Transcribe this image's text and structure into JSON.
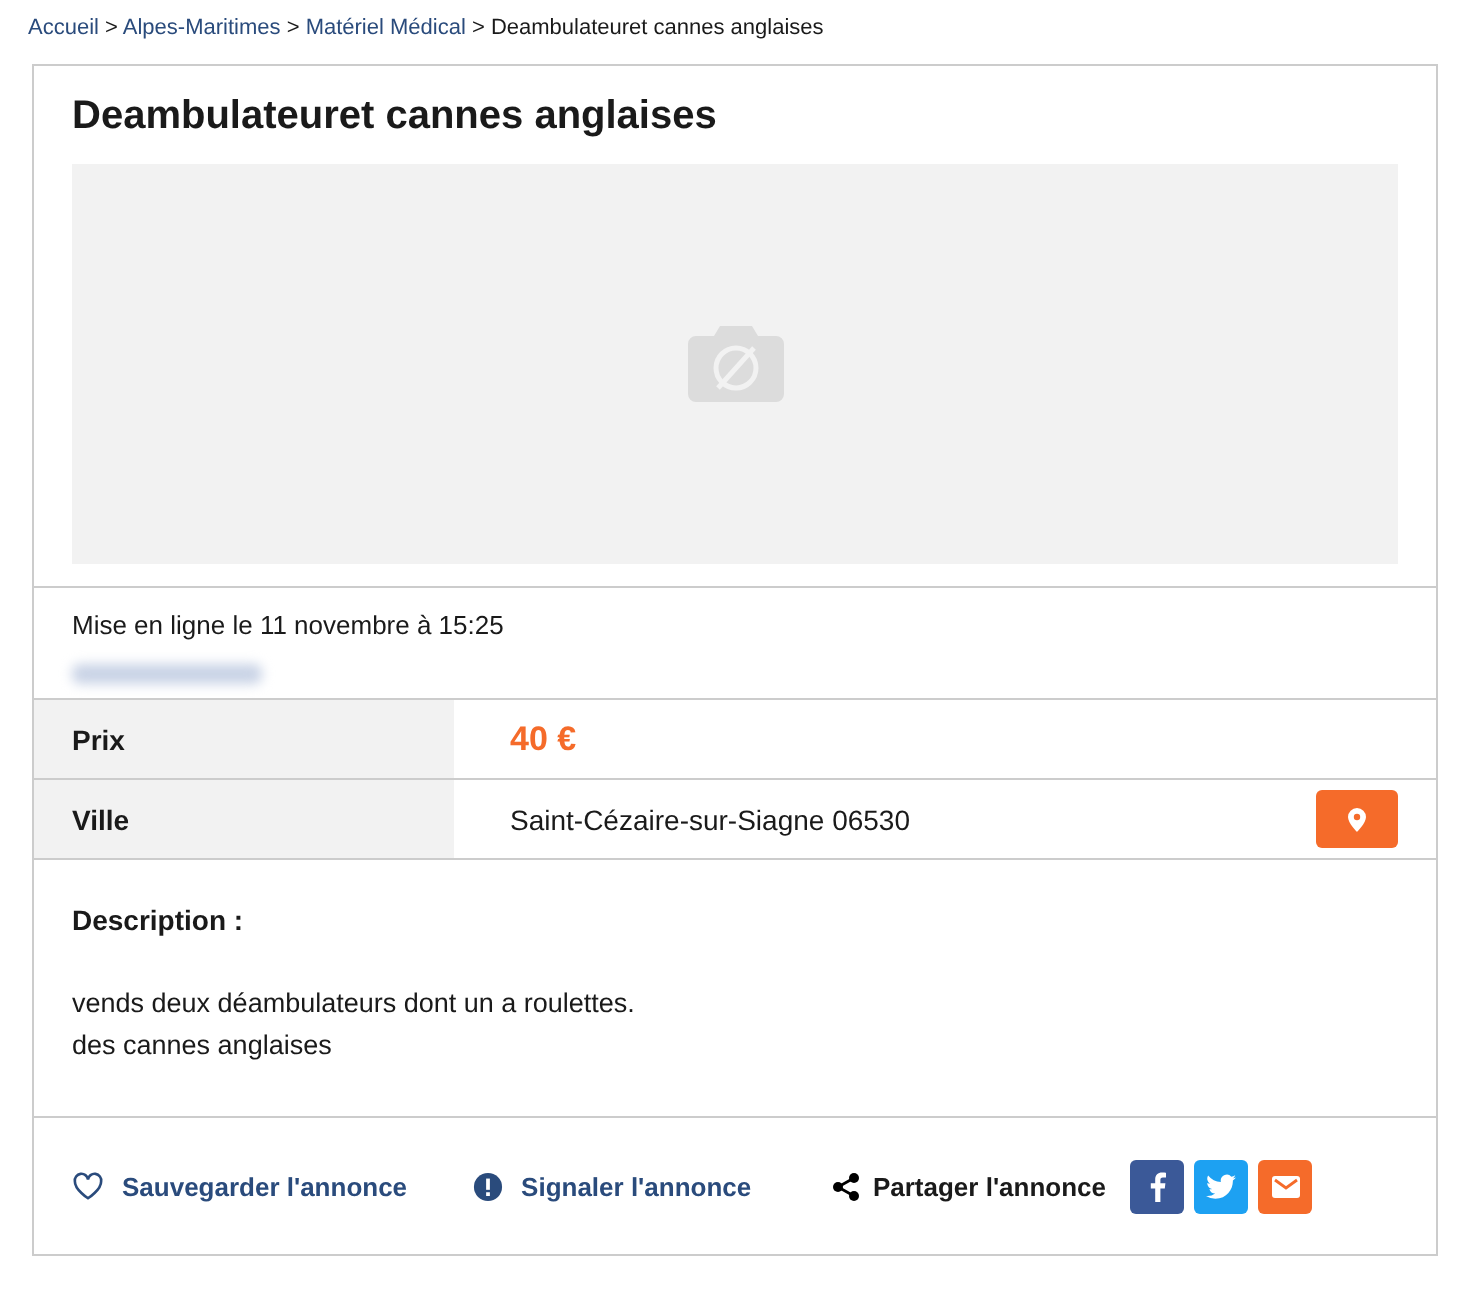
{
  "breadcrumb": [
    {
      "label": "Accueil",
      "kind": "link"
    },
    {
      "label": "Alpes-Maritimes",
      "kind": "link"
    },
    {
      "label": "Matériel Médical",
      "kind": "link"
    },
    {
      "label": "Deambulateuret cannes anglaises",
      "kind": "current"
    }
  ],
  "breadcrumb_separator": ">",
  "title": "Deambulateuret cannes anglaises",
  "posted": "Mise en ligne le 11 novembre à 15:25",
  "details": [
    {
      "label": "Prix",
      "value": "40 €",
      "kind": "price"
    },
    {
      "label": "Ville",
      "value": "Saint-Cézaire-sur-Siagne 06530",
      "kind": "location"
    }
  ],
  "description": {
    "heading": "Description :",
    "lines": [
      "vends deux déambulateurs dont un a roulettes.",
      "des cannes anglaises"
    ]
  },
  "actions": [
    {
      "label": "Sauvegarder l'annonce",
      "kind": "save"
    },
    {
      "label": "Signaler l'annonce",
      "kind": "report"
    }
  ],
  "share": {
    "label": "Partager l'annonce",
    "buttons": [
      {
        "kind": "facebook",
        "color": "#3b5998"
      },
      {
        "kind": "twitter",
        "color": "#1da1f2"
      },
      {
        "kind": "email",
        "color": "#f56b2a"
      }
    ]
  }
}
